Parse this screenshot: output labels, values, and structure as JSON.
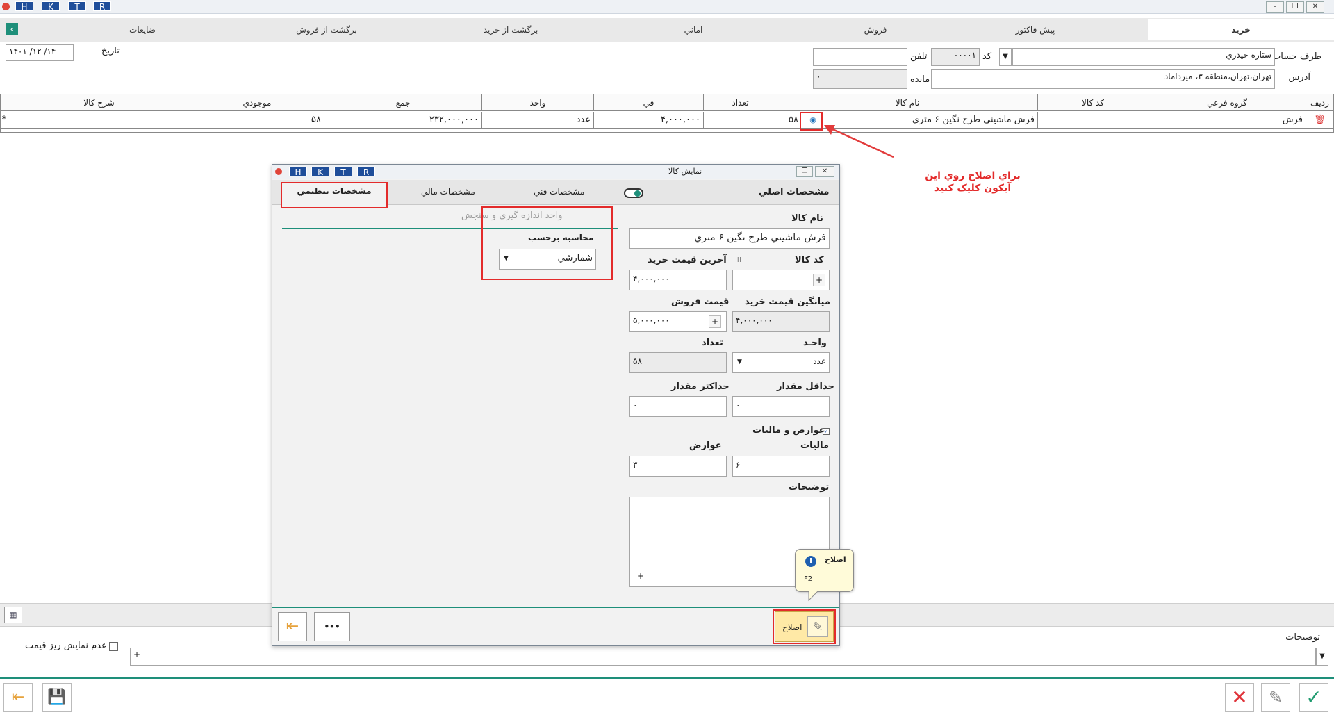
{
  "window": {
    "hotkeys": [
      "H",
      "K",
      "T",
      "R"
    ],
    "min": "–",
    "max": "❐",
    "close": "✕"
  },
  "tabs": [
    "خريد",
    "پيش فاکتور",
    "فروش",
    "اماني",
    "برگشت از خريد",
    "برگشت از فروش",
    "ضايعات"
  ],
  "header": {
    "account_label": "طرف حساب",
    "account_value": "ستاره حيدري",
    "code_label": "کد",
    "code_value": "۰۰۰۰۱",
    "phone_label": "تلفن",
    "phone_value": "",
    "date_label": "تاريخ",
    "date_value": "۱۴۰۱ /۱۲ /۱۴",
    "address_label": "آدرس",
    "address_value": "تهران،تهران،منطقه ۳، ميرداماد",
    "balance_label": "مانده",
    "balance_value": "۰"
  },
  "grid": {
    "columns": [
      "رديف",
      "گروه فرعي",
      "کد کالا",
      "نام کالا",
      "تعداد",
      "في",
      "واحد",
      "جمع",
      "موجودي",
      "شرح کالا"
    ],
    "row": {
      "group": "فرش",
      "code": "",
      "name": "فرش ماشيني طرح نگين ۶ متري",
      "qty": "۵۸",
      "price": "۴,۰۰۰,۰۰۰",
      "unit": "عدد",
      "total": "۲۳۲,۰۰۰,۰۰۰",
      "stock": "۵۸",
      "desc": "",
      "marker": "*"
    }
  },
  "annotation": {
    "line1": "براي اصلاح روي اين",
    "line2": "آيکون کليک کنيد"
  },
  "dialog": {
    "title": "نمايش کالا",
    "hotkeys": [
      "H",
      "K",
      "T",
      "R"
    ],
    "tabs": {
      "main": "مشخصات اصلي",
      "tech": "مشخصات فني",
      "fin": "مشخصات مالي",
      "settings": "مشخصات تنظيمي"
    },
    "fields": {
      "name_label": "نام کالا",
      "name_value": "فرش ماشيني طرح نگين ۶ متري",
      "code_label": "کد کالا",
      "code_value": "",
      "last_buy_label": "آخرين قيمت خريد",
      "last_buy_value": "۴,۰۰۰,۰۰۰",
      "avg_buy_label": "ميانگين قيمت خريد",
      "avg_buy_value": "۴,۰۰۰,۰۰۰",
      "sell_label": "قيمت فروش",
      "sell_value": "۵,۰۰۰,۰۰۰",
      "unit_label": "واحـد",
      "unit_value": "عدد",
      "qty_label": "تعداد",
      "qty_value": "۵۸",
      "min_label": "حداقل مقدار",
      "min_value": "۰",
      "max_label": "حداکثر مقدار",
      "max_value": "۰",
      "tax_section": "عوارض و ماليات",
      "tax_label": "ماليات",
      "tax_value": "۶",
      "duty_label": "عوارض",
      "duty_value": "۳",
      "desc_label": "توضيحات",
      "desc_plus": "+"
    },
    "settings": {
      "measure_title": "واحد اندازه گيري و سنجش",
      "calc_label": "محاسبه برحسب",
      "calc_value": "شمارشي"
    },
    "tooltip": {
      "title": "اصلاح",
      "shortcut": "F2"
    },
    "edit_label": "اصلاح",
    "more_label": "•••"
  },
  "footer": {
    "notes_label": "توضيحات",
    "notes_value": "+",
    "hide_price_label": "عدم نمايش ريز قيمت"
  }
}
